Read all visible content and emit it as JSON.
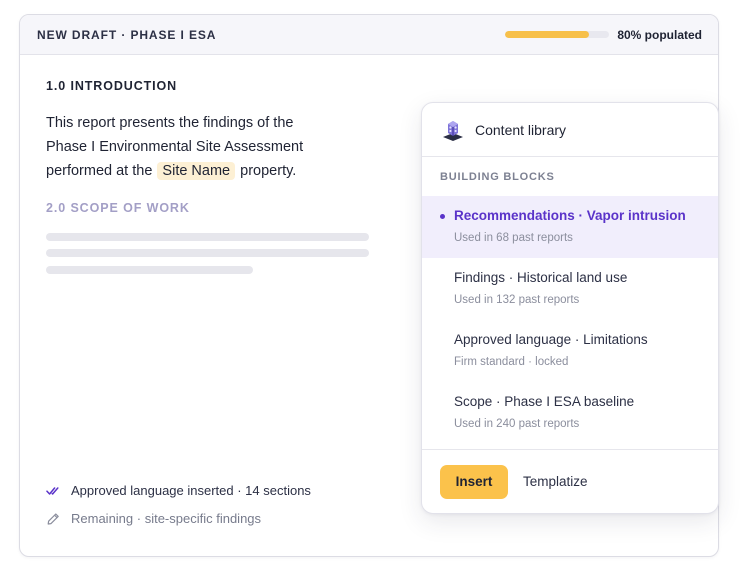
{
  "draft": {
    "title": "NEW DRAFT · PHASE I ESA",
    "progress_fraction": 0.8,
    "progress_label": "80% populated",
    "accent_color": "#f7c04a"
  },
  "document": {
    "section_1_heading": "1.0 INTRODUCTION",
    "intro_before": "This report presents the findings of the Phase I Environmental Site Assessment performed at the ",
    "placeholder": "Site Name",
    "intro_after": " property.",
    "section_2_heading": "2.0 SCOPE OF WORK"
  },
  "status": [
    {
      "icon": "double-check-icon",
      "text": "Approved language inserted · 14 sections"
    },
    {
      "icon": "pencil-icon",
      "text": "Remaining · site-specific findings"
    }
  ],
  "library": {
    "icon": "library-logo-icon",
    "title": "Content library",
    "section_label": "BUILDING BLOCKS",
    "items": [
      {
        "title": "Recommendations · Vapor intrusion",
        "meta": "Used in 68 past reports",
        "selected": true
      },
      {
        "title": "Findings · Historical land use",
        "meta": "Used in 132 past reports",
        "selected": false
      },
      {
        "title": "Approved language · Limitations",
        "meta": "Firm standard · locked",
        "selected": false
      },
      {
        "title": "Scope · Phase I ESA baseline",
        "meta": "Used in 240 past reports",
        "selected": false
      }
    ],
    "insert_label": "Insert",
    "templatize_label": "Templatize",
    "selected_color": "#5a33c9"
  }
}
